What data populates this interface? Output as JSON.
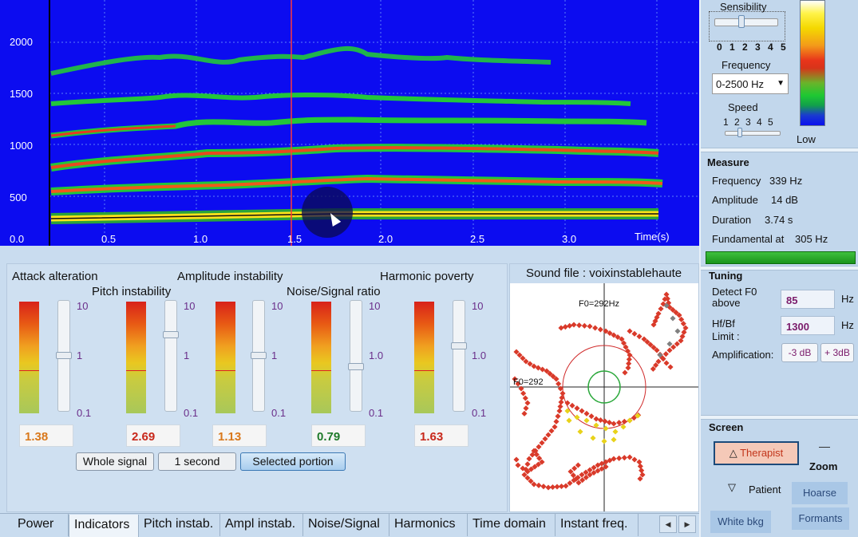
{
  "spectrogram": {
    "y_labels": [
      "2000",
      "1500",
      "1000",
      "500",
      "0.0"
    ],
    "x_labels": [
      "0.5",
      "1.0",
      "1.5",
      "2.0",
      "2.5",
      "3.0"
    ],
    "x_axis_label": "Time(s)"
  },
  "controls": {
    "sensibility_label": "Sensibility",
    "sensibility_scale": "0 1 2 3 4 5",
    "sensibility_level": 1,
    "frequency_label": "Frequency",
    "frequency_value": "0-2500 Hz",
    "speed_label": "Speed",
    "speed_scale": "1 2 3 4 5",
    "speed_level": 1,
    "low_label": "Low"
  },
  "measure": {
    "title": "Measure",
    "rows": [
      {
        "label": "Frequency",
        "value": "339 Hz"
      },
      {
        "label": "Amplitude",
        "value": "14 dB"
      },
      {
        "label": "Duration",
        "value": "3.74 s"
      },
      {
        "label": "Fundamental at",
        "value": "305 Hz"
      }
    ]
  },
  "tuning": {
    "title": "Tuning",
    "detect_label_1": "Detect F0",
    "detect_label_2": "above",
    "detect_value": "85",
    "detect_unit": "Hz",
    "hfbf_label_1": "Hf/Bf",
    "hfbf_label_2": "Limit :",
    "hfbf_value": "1300",
    "hfbf_unit": "Hz",
    "amplification_label": "Amplification:",
    "minus_label": "-3 dB",
    "plus_label": "+ 3dB"
  },
  "screen": {
    "title": "Screen",
    "therapist_label": "Therapist",
    "zoom_label": "Zoom",
    "patient_label": "Patient",
    "hoarse_label": "Hoarse",
    "white_bkg_label": "White bkg",
    "formants_label": "Formants"
  },
  "indicators": {
    "titles": {
      "attack": "Attack alteration",
      "pitch": "Pitch instability",
      "amplitude": "Amplitude instability",
      "noise": "Noise/Signal ratio",
      "harmonic": "Harmonic poverty"
    },
    "scale_a": {
      "top": "10",
      "mid": "1",
      "bottom": "0.1"
    },
    "scale_b": {
      "top": "10",
      "mid": "1.0",
      "bottom": "0.1"
    },
    "values": {
      "attack": "1.38",
      "pitch": "2.69",
      "amplitude": "1.13",
      "noise": "0.79",
      "harmonic": "1.63"
    },
    "value_colors": {
      "attack": "#d9781b",
      "pitch": "#c8281b",
      "amplitude": "#d9781b",
      "noise": "#1e7a2a",
      "harmonic": "#c8281b"
    },
    "buttons": {
      "whole": "Whole signal",
      "second": "1 second",
      "selected": "Selected portion"
    }
  },
  "sound_file": {
    "title": "Sound file : voixinstablehaute",
    "f0_top": "F0=292Hz",
    "f0_left": "F0=292"
  },
  "tabs": [
    "Power",
    "Indicators",
    "Pitch instab.",
    "Ampl instab.",
    "Noise/Signal",
    "Harmonics",
    "Time domain",
    "Instant freq."
  ],
  "active_tab": "Indicators",
  "colors": {
    "spectrogram_bg": "#0c0cf0",
    "panel_bg": "#c9dcef",
    "meter_green": "#2bb52b"
  }
}
